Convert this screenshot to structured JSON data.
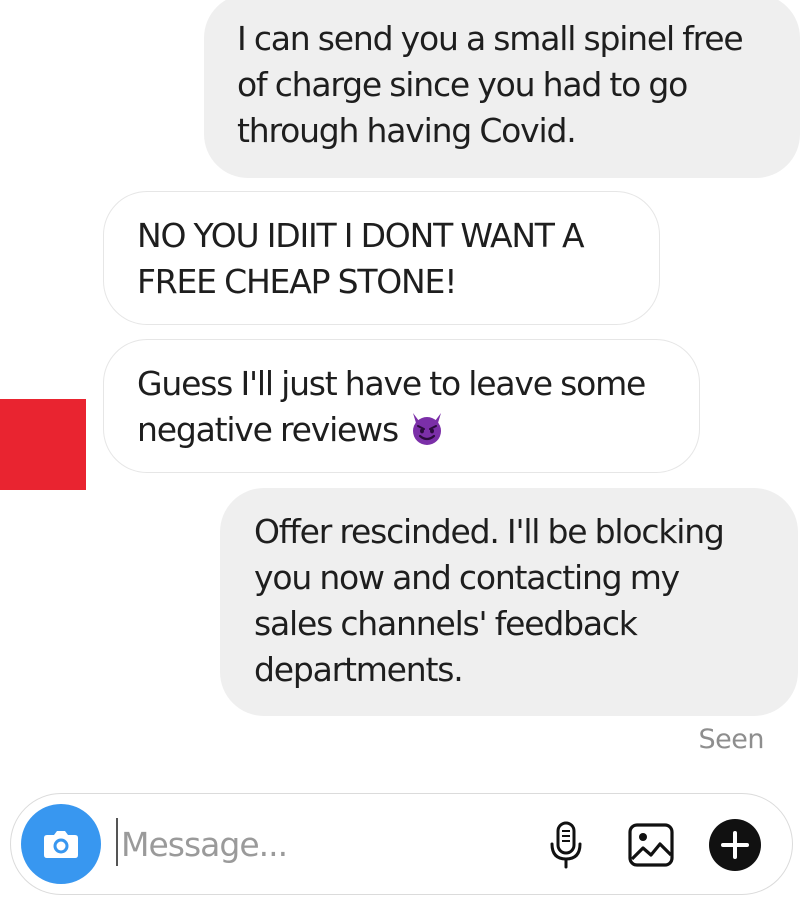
{
  "messages": [
    {
      "direction": "outgoing",
      "lines": [
        "I can send you a small spinel free",
        "of charge since you had to go",
        "through having Covid."
      ]
    },
    {
      "direction": "incoming",
      "lines": [
        "NO YOU IDIIT I DONT WANT A",
        "FREE CHEAP STONE!"
      ]
    },
    {
      "direction": "incoming",
      "lines": [
        "Guess I'll just have to leave some",
        "negative reviews"
      ],
      "emoji": "smiling-face-with-horns"
    },
    {
      "direction": "outgoing",
      "lines": [
        "Offer rescinded. I'll be blocking",
        "you now and contacting my",
        "sales channels' feedback",
        "departments."
      ]
    }
  ],
  "status": {
    "seen": "Seen"
  },
  "composer": {
    "placeholder": "Message...",
    "value": "",
    "icons": [
      "camera-icon",
      "microphone-icon",
      "image-icon",
      "plus-icon"
    ]
  },
  "colors": {
    "outgoing_bubble": "#efefef",
    "incoming_border": "#e6e6e6",
    "camera_button": "#3897f0",
    "red_block": "#e92430",
    "devil_emoji": "#7b2fa8"
  }
}
